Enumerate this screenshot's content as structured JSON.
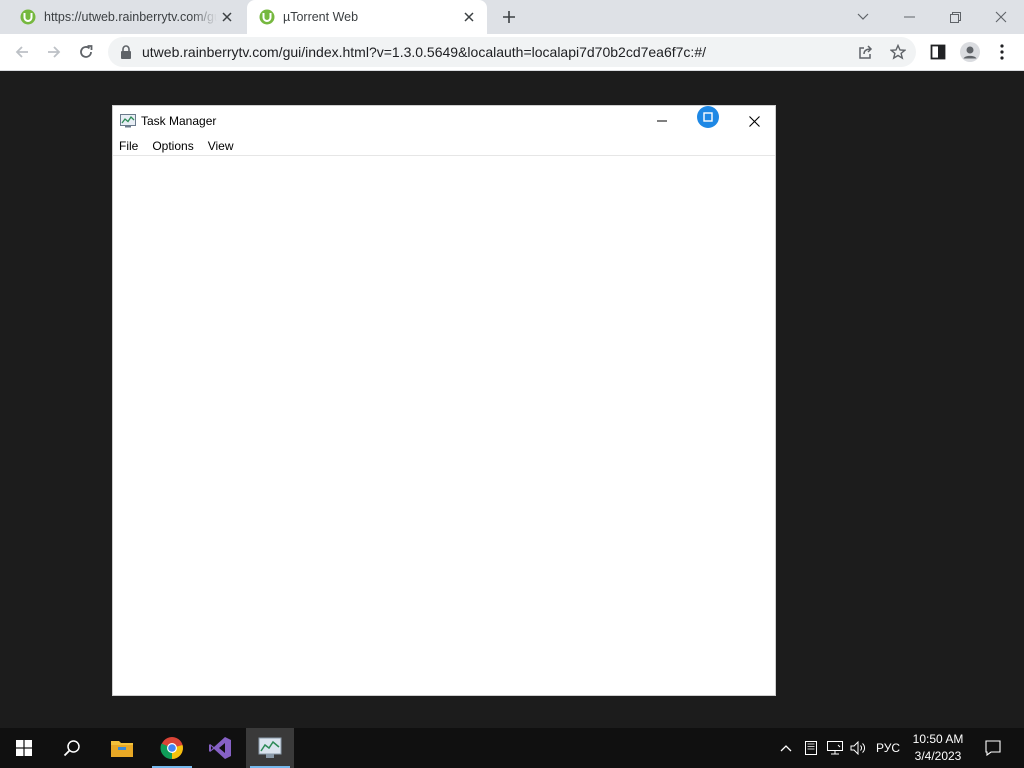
{
  "browser": {
    "tabs": [
      {
        "title": "https://utweb.rainberrytv.com/gui/index.html",
        "active": false,
        "icon": "utorrent-icon"
      },
      {
        "title": "µTorrent Web",
        "active": true,
        "icon": "utorrent-icon"
      }
    ],
    "url": "utweb.rainberrytv.com/gui/index.html?v=1.3.0.5649&localauth=localapi7d70b2cd7ea6f7c:#/"
  },
  "task_manager": {
    "title": "Task Manager",
    "menu": [
      "File",
      "Options",
      "View"
    ]
  },
  "taskbar": {
    "apps": [
      "windows-start-icon",
      "search-icon",
      "file-explorer-icon",
      "chrome-icon",
      "visual-studio-icon",
      "task-manager-icon"
    ],
    "language": "РУС",
    "time": "10:50 AM",
    "date": "3/4/2023"
  },
  "colors": {
    "desktop": "#1c1c1c",
    "taskbar": "#101010",
    "tab_strip": "#dee1e6",
    "utorrent_green": "#76b83f",
    "accent_blue": "#1e88e5"
  }
}
